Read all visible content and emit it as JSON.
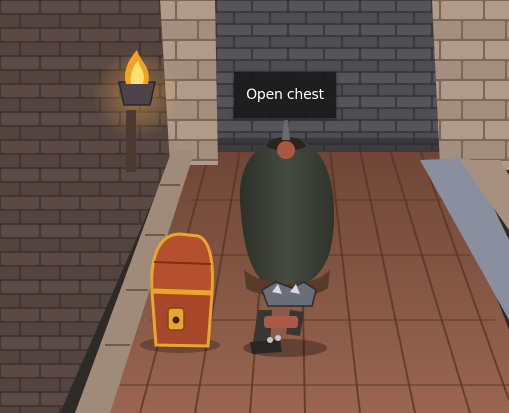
{
  "interaction_prompt": {
    "label": "Open chest",
    "target_icon": "treasure-chest-icon"
  },
  "scene": {
    "objects": [
      "wall-torch-icon",
      "treasure-chest-icon",
      "player-character-icon"
    ],
    "colors": {
      "floor": "#8a5a44",
      "wall": "#5a4a44",
      "back_wall": "#4a4a4e",
      "pillar": "#a89080",
      "chest_wood": "#b4502e",
      "chest_trim": "#e8a72a",
      "cloak": "#3e4438",
      "flame": "#f4a224"
    }
  }
}
